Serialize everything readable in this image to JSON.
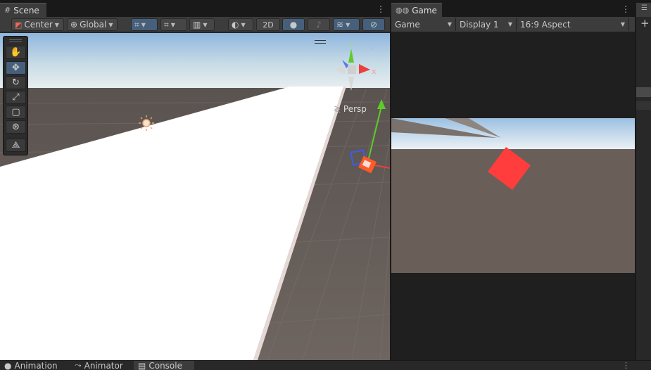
{
  "scene": {
    "tab_label": "Scene",
    "pivot_label": "Center",
    "space_label": "Global",
    "mode_2d_label": "2D",
    "persp_label": "Persp",
    "gizmo_y_label": "y",
    "gizmo_x_label": "x",
    "gizmo_z_label": "z"
  },
  "game": {
    "tab_label": "Game",
    "view_label": "Game",
    "display_label": "Display 1",
    "aspect_label": "16:9 Aspect"
  },
  "bottom_tabs": {
    "animation_label": "Animation",
    "animator_label": "Animator",
    "console_label": "Console"
  },
  "icons": {
    "scene_tab": "grid-icon",
    "game_tab": "gamepad-icon",
    "hand_tool": "hand-icon",
    "move_tool": "move-icon",
    "rotate_tool": "rotate-icon",
    "scale_tool": "scale-icon",
    "rect_tool": "rect-icon",
    "transform_tool": "transform-icon",
    "custom_tool": "custom-tool-icon",
    "light": "sun-icon"
  },
  "colors": {
    "accent": "#46607c",
    "cube_red": "#ff3d3d",
    "gizmo_green": "#5ecb2a",
    "gizmo_red": "#e8423a",
    "gizmo_blue": "#3a5ee8"
  }
}
